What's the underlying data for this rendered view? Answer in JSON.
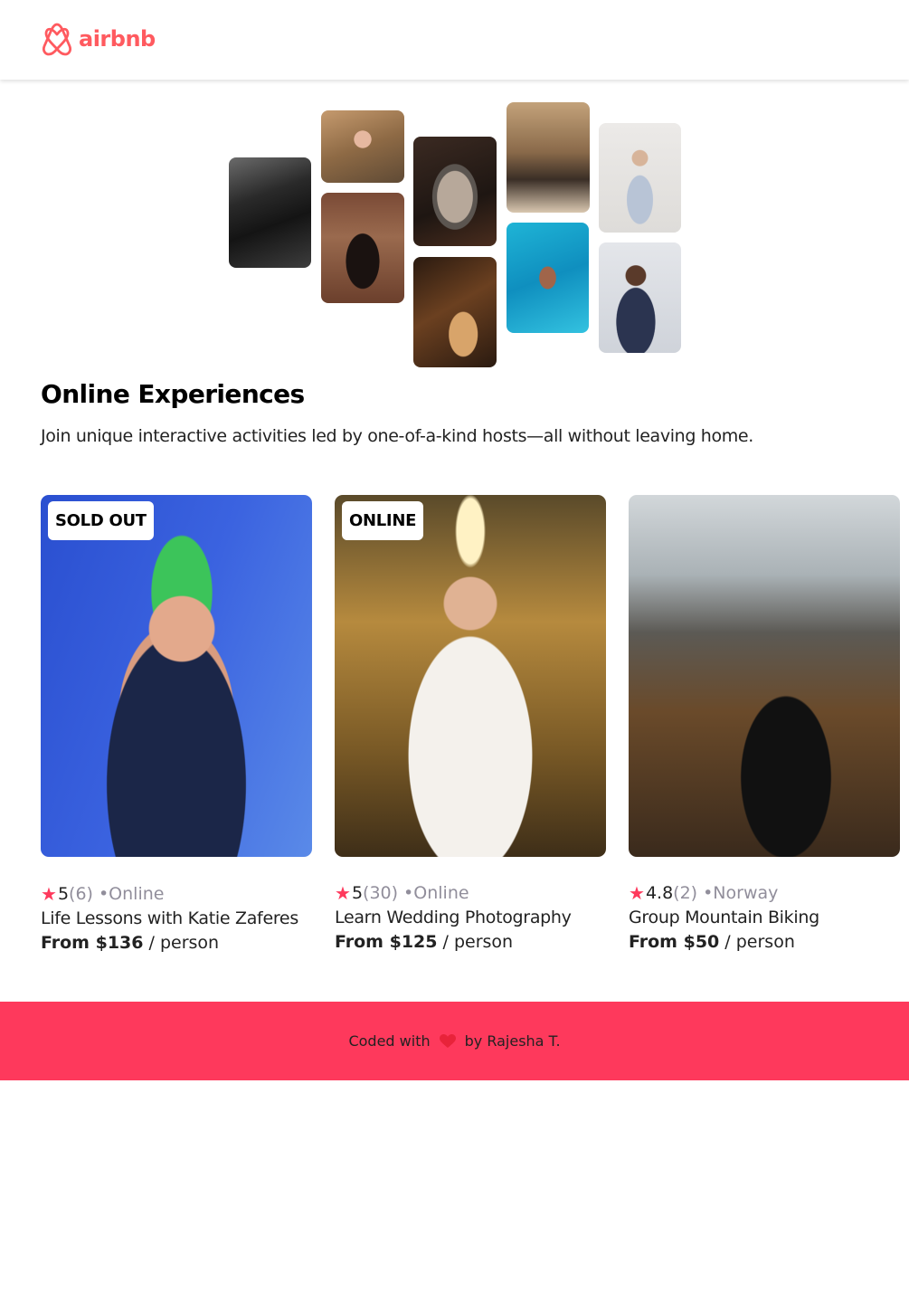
{
  "brand": {
    "name": "airbnb",
    "color": "#FF5A5F",
    "icon": "airbnb-logo-icon"
  },
  "hero": {
    "photos": [
      "cooking",
      "woman-portrait",
      "dancer",
      "food-bowl",
      "guitar",
      "piano-singer",
      "swimmer",
      "yoga",
      "singer"
    ]
  },
  "section": {
    "title": "Online Experiences",
    "description": "Join unique interactive activities led by one-of-a-kind hosts—all without leaving home."
  },
  "cards": [
    {
      "badge": "SOLD OUT",
      "rating": "5",
      "count": "(6)",
      "separator": "•",
      "location": "Online",
      "title": "Life Lessons with Katie Zaferes",
      "price": "From $136",
      "unit": " / person"
    },
    {
      "badge": "ONLINE",
      "rating": "5",
      "count": "(30)",
      "separator": "•",
      "location": "Online",
      "title": "Learn Wedding Photography",
      "price": "From $125",
      "unit": " / person"
    },
    {
      "badge": "",
      "rating": "4.8",
      "count": "(2)",
      "separator": "•",
      "location": "Norway",
      "title": "Group Mountain Biking",
      "price": "From $50",
      "unit": " / person"
    }
  ],
  "footer": {
    "prefix": "Coded with",
    "suffix": "by Rajesha T.",
    "icon": "heart-icon"
  },
  "colors": {
    "accent": "#FE395C",
    "muted": "#918E9B"
  }
}
